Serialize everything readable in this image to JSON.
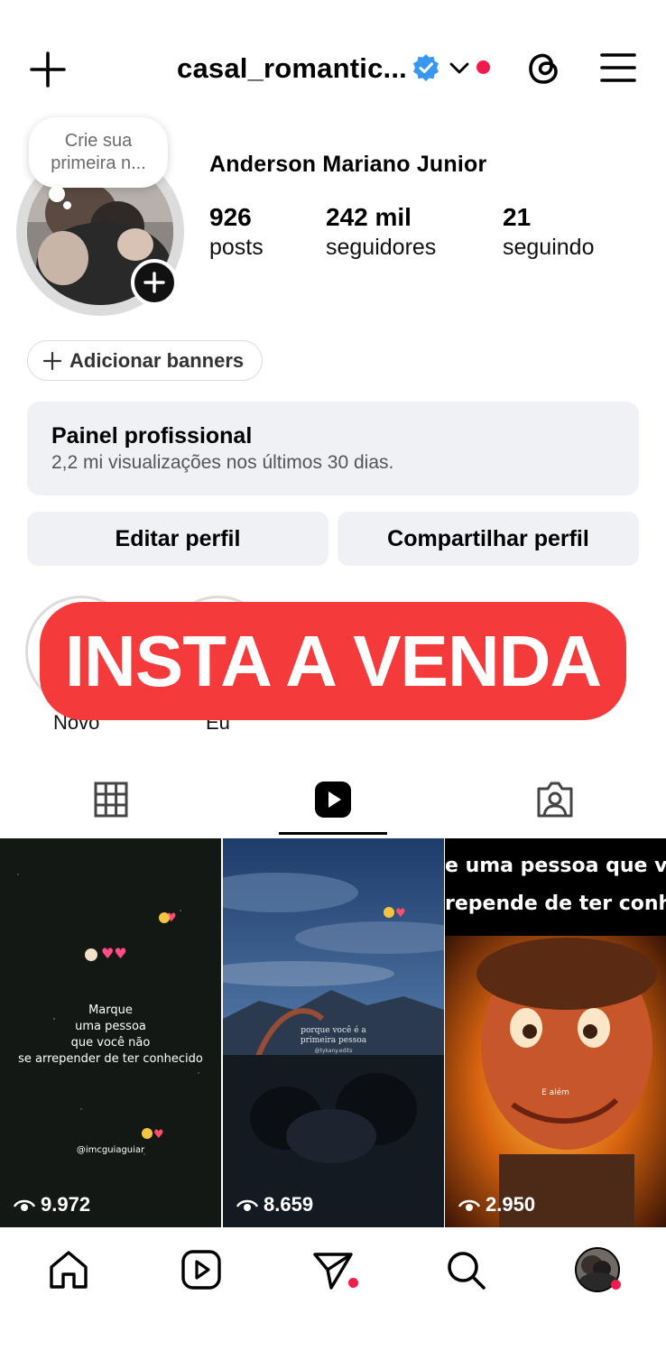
{
  "header": {
    "username": "casal_romantic...",
    "icons": [
      "plus-icon",
      "verified-badge-icon",
      "chevron-down-icon",
      "threads-icon",
      "menu-icon"
    ],
    "notification_dot_color": "#ee1d4d",
    "verified_color": "#3897f0"
  },
  "profile": {
    "note_text": "Crie sua primeira n...",
    "full_name": "Anderson Mariano Junior",
    "stats": [
      {
        "value": "926",
        "label": "posts"
      },
      {
        "value": "242 mil",
        "label": "seguidores"
      },
      {
        "value": "21",
        "label": "seguindo"
      }
    ]
  },
  "banners_button": "Adicionar banners",
  "dashboard": {
    "title": "Painel profissional",
    "subtitle": "2,2 mi visualizações nos últimos 30 dias."
  },
  "actions": {
    "edit": "Editar perfil",
    "share": "Compartilhar perfil"
  },
  "highlights": [
    {
      "label": "Novo"
    },
    {
      "label": "Eu"
    }
  ],
  "overlay_banner": {
    "text": "INSTA A VENDA",
    "color": "#f43a3a"
  },
  "tabs": [
    {
      "name": "grid-icon"
    },
    {
      "name": "reels-icon",
      "active": true
    },
    {
      "name": "tagged-icon"
    }
  ],
  "posts": [
    {
      "views": "9.972",
      "caption_lines": [
        "Marque",
        "uma pessoa",
        "que você não",
        "se arrepender de ter conhecido"
      ],
      "handle": "@imcguiaguiar"
    },
    {
      "views": "8.659",
      "caption_lines": [
        "porque você é a",
        "primeira pessoa"
      ],
      "handle": "@tykany.edits"
    },
    {
      "views": "2.950",
      "caption_lines": [
        "e uma pessoa que você n",
        "repende de ter conhecid"
      ],
      "inner_text": "E além"
    }
  ],
  "bottom_nav": [
    "home-icon",
    "reels-icon",
    "direct-icon",
    "search-icon",
    "profile-avatar"
  ]
}
